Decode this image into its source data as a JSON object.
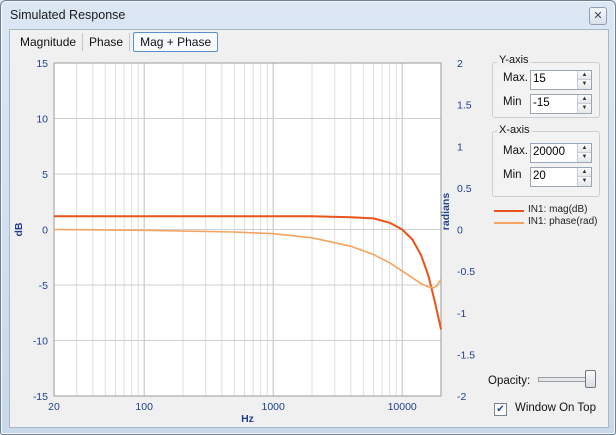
{
  "window": {
    "title": "Simulated Response",
    "close_glyph": "✕"
  },
  "tabs": [
    {
      "label": "Magnitude",
      "active": false
    },
    {
      "label": "Phase",
      "active": false
    },
    {
      "label": "Mag + Phase",
      "active": true
    }
  ],
  "yaxis_group": {
    "title": "Y-axis",
    "max_label": "Max.",
    "max_value": "15",
    "min_label": "Min",
    "min_value": "-15"
  },
  "xaxis_group": {
    "title": "X-axis",
    "max_label": "Max.",
    "max_value": "20000",
    "min_label": "Min",
    "min_value": "20"
  },
  "legend": [
    {
      "label": "IN1: mag(dB)",
      "color": "#e8541a"
    },
    {
      "label": "IN1: phase(rad)",
      "color": "#f4a460"
    }
  ],
  "opacity": {
    "label": "Opacity:",
    "value": 1.0
  },
  "window_on_top": {
    "label": "Window On Top",
    "checked": true
  },
  "chart_data": {
    "type": "line",
    "xscale": "log",
    "xlim": [
      20,
      20000
    ],
    "ylim_left": [
      -15,
      15
    ],
    "ylim_right": [
      -2,
      2
    ],
    "xlabel": "Hz",
    "ylabel_left": "dB",
    "ylabel_right": "radians",
    "x_ticks": [
      "20",
      "100",
      "1000",
      "10000"
    ],
    "y_ticks_left": [
      "15",
      "10",
      "5",
      "0",
      "-5",
      "-10",
      "-15"
    ],
    "y_ticks_right": [
      "2",
      "1.5",
      "1",
      "0.5",
      "0",
      "-0.5",
      "-1",
      "-1.5",
      "-2"
    ],
    "grid": true,
    "series": [
      {
        "name": "IN1: mag(dB)",
        "axis": "left",
        "color": "#e8541a",
        "x": [
          20,
          100,
          500,
          1000,
          2000,
          4000,
          6000,
          8000,
          10000,
          12000,
          14000,
          16000,
          18000,
          20000
        ],
        "y": [
          1.2,
          1.2,
          1.2,
          1.2,
          1.2,
          1.1,
          1.0,
          0.6,
          0.0,
          -0.9,
          -2.3,
          -4.2,
          -6.6,
          -9.0
        ]
      },
      {
        "name": "IN1: phase(rad)",
        "axis": "right",
        "color": "#f4a460",
        "x": [
          20,
          100,
          500,
          1000,
          2000,
          4000,
          6000,
          8000,
          10000,
          12000,
          14000,
          16000,
          17500,
          18500,
          20000
        ],
        "y": [
          0.0,
          -0.01,
          -0.03,
          -0.05,
          -0.1,
          -0.2,
          -0.3,
          -0.4,
          -0.5,
          -0.58,
          -0.65,
          -0.69,
          -0.7,
          -0.68,
          -0.6
        ]
      }
    ]
  }
}
